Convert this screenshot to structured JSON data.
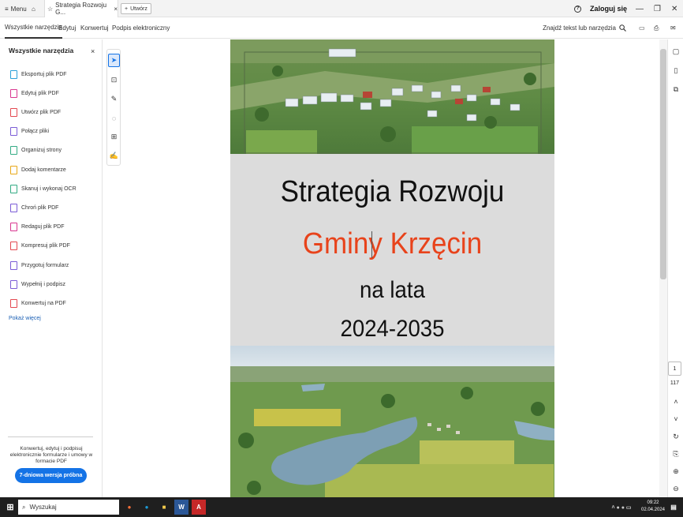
{
  "tabbar": {
    "menu_label": "Menu",
    "doc_tab_title": "Strategia Rozwoju G...",
    "new_tab_label": "Utwórz",
    "signin_label": "Zaloguj się"
  },
  "toolbar": {
    "tabs": [
      "Wszystkie narzędzia",
      "Edytuj",
      "Konwertuj",
      "Podpis elektroniczny"
    ],
    "search_label": "Znajdź tekst lub narzędzia"
  },
  "sidebar": {
    "title": "Wszystkie narzędzia",
    "close": "×",
    "items": [
      {
        "label": "Eksportuj plik PDF",
        "color": "#2a9fd8"
      },
      {
        "label": "Edytuj plik PDF",
        "color": "#d83790"
      },
      {
        "label": "Utwórz plik PDF",
        "color": "#e34850"
      },
      {
        "label": "Połącz pliki",
        "color": "#7b5cd6"
      },
      {
        "label": "Organizuj strony",
        "color": "#33ab84"
      },
      {
        "label": "Dodaj komentarze",
        "color": "#e8a817"
      },
      {
        "label": "Skanuj i wykonaj OCR",
        "color": "#33ab84"
      },
      {
        "label": "Chroń plik PDF",
        "color": "#7b5cd6"
      },
      {
        "label": "Redaguj plik PDF",
        "color": "#d83790"
      },
      {
        "label": "Kompresuj plik PDF",
        "color": "#e34850"
      },
      {
        "label": "Przygotuj formularz",
        "color": "#7b5cd6"
      },
      {
        "label": "Wypełnij i podpisz",
        "color": "#7b5cd6"
      },
      {
        "label": "Konwertuj na PDF",
        "color": "#e34850"
      }
    ],
    "show_more": "Pokaż więcej",
    "promo_text": "Konwertuj, edytuj i podpisuj elektronicznie formularze i umowy w formacie PDF",
    "trial_button": "7-dniowa wersja próbna"
  },
  "document": {
    "title": "Strategia Rozwoju",
    "subtitle": "Gminy Krzęcin",
    "line3": "na lata",
    "years": "2024-2035",
    "title_color": "#111111",
    "subtitle_color": "#e8431b"
  },
  "navigation": {
    "current_page": "1",
    "total_pages": "117"
  },
  "taskbar": {
    "search_placeholder": "Wyszukaj",
    "time": "09:22",
    "date": "02.04.2024"
  },
  "colors": {
    "accent": "#1473e6"
  }
}
